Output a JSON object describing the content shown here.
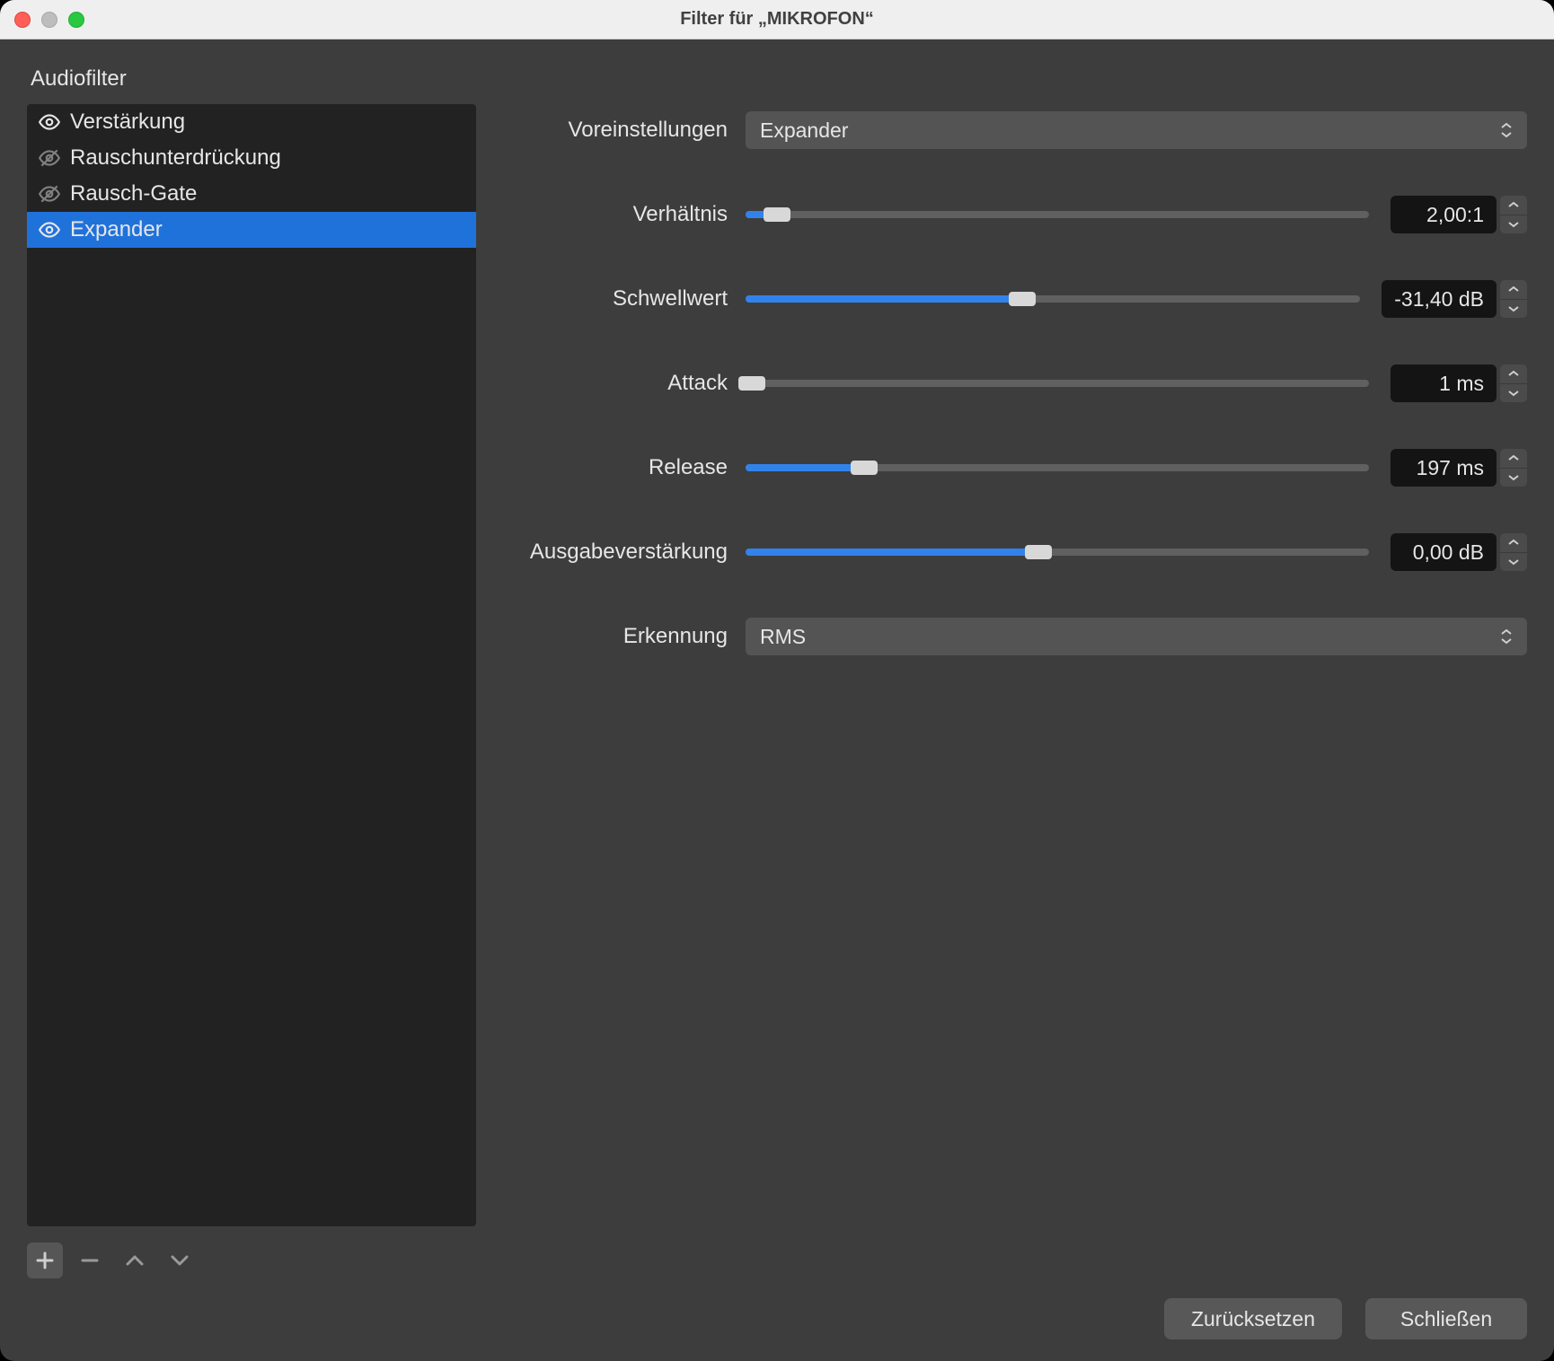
{
  "window": {
    "title": "Filter für „MIKROFON“"
  },
  "sidebar": {
    "section_label": "Audiofilter",
    "items": [
      {
        "label": "Verstärkung",
        "visible": true,
        "selected": false
      },
      {
        "label": "Rauschunterdrückung",
        "visible": false,
        "selected": false
      },
      {
        "label": "Rausch-Gate",
        "visible": false,
        "selected": false
      },
      {
        "label": "Expander",
        "visible": true,
        "selected": true
      }
    ]
  },
  "panel": {
    "preset_label": "Voreinstellungen",
    "preset_value": "Expander",
    "detection_label": "Erkennung",
    "detection_value": "RMS",
    "params": {
      "ratio": {
        "label": "Verhältnis",
        "value": "2,00:1",
        "fill_pct": 5
      },
      "thresh": {
        "label": "Schwellwert",
        "value": "-31,40 dB",
        "fill_pct": 45
      },
      "attack": {
        "label": "Attack",
        "value": "1 ms",
        "fill_pct": 1
      },
      "release": {
        "label": "Release",
        "value": "197 ms",
        "fill_pct": 19
      },
      "outgain": {
        "label": "Ausgabeverstärkung",
        "value": "0,00 dB",
        "fill_pct": 47
      }
    }
  },
  "footer": {
    "reset": "Zurücksetzen",
    "close": "Schließen"
  }
}
